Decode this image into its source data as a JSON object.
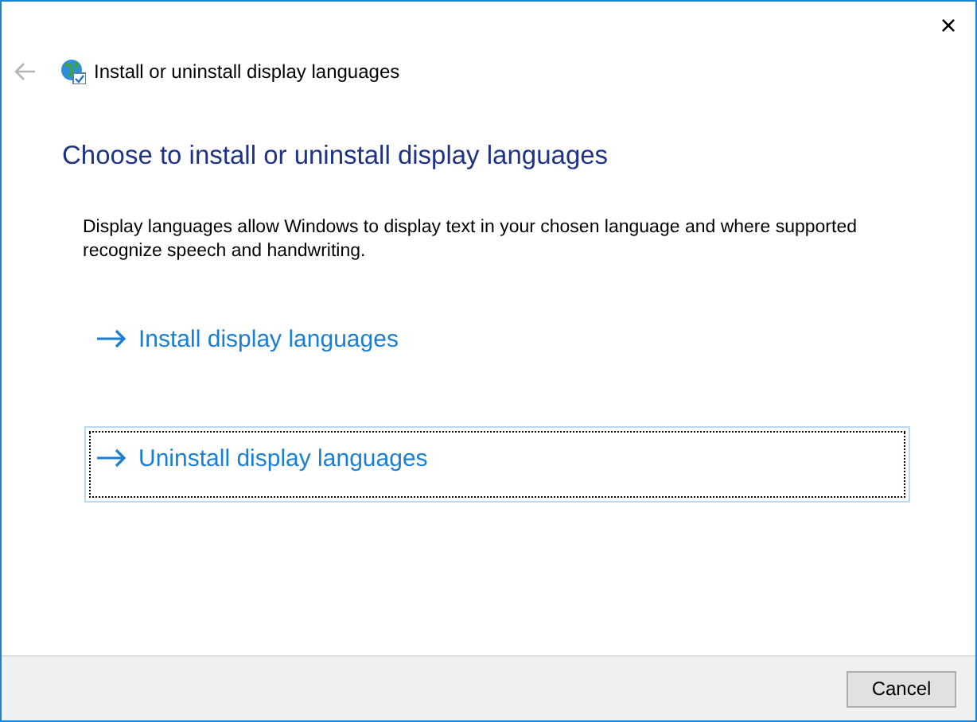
{
  "window": {
    "title": "Install or uninstall display languages",
    "close": "×"
  },
  "heading": "Choose to install or uninstall display languages",
  "description": "Display languages allow Windows to display text in your chosen language and where supported recognize speech and handwriting.",
  "options": [
    {
      "label": "Install display languages",
      "focused": false
    },
    {
      "label": "Uninstall display languages",
      "focused": true
    }
  ],
  "buttons": [
    "Cancel"
  ]
}
